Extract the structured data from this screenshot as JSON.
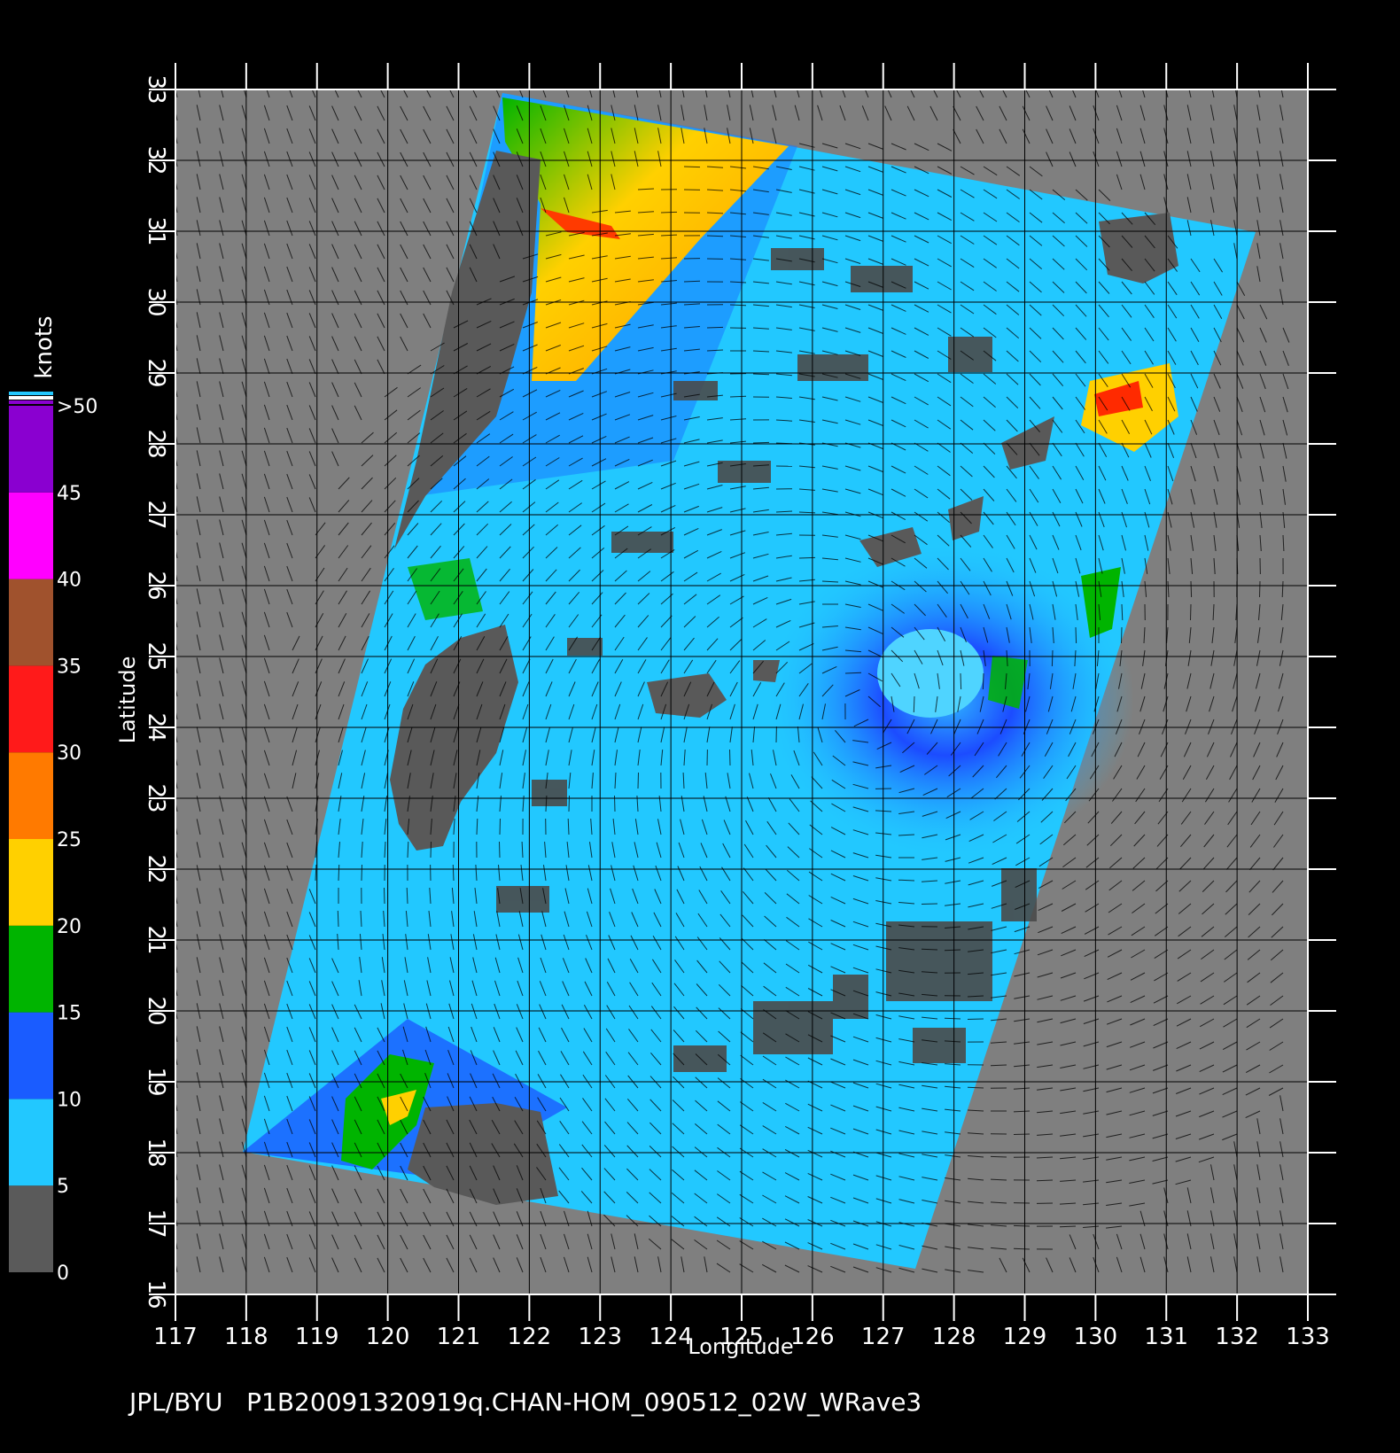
{
  "figure": {
    "footer": "JPL/BYU   P1B20091320919q.CHAN-HOM_090512_02W_WRave3",
    "colorbar": {
      "unit_label": "knots",
      "ticks": [
        "0",
        "5",
        "10",
        "15",
        "20",
        "25",
        "30",
        "35",
        "40",
        "45",
        ">50"
      ],
      "colors": {
        "0-5": "#5a5a5a",
        "5-10": "#22c8ff",
        "10-15": "#1a5cff",
        "15-20": "#00b400",
        "20-25": "#ffd000",
        "25-30": "#ff7a00",
        "30-35": "#ff1a1a",
        "35-40": "#a0522d",
        "40-45": "#ff00ff",
        "45-50": "#8a00d0"
      }
    },
    "axes": {
      "xlabel": "Longitude",
      "ylabel": "Latitude",
      "x_ticks": [
        "117",
        "118",
        "119",
        "120",
        "121",
        "122",
        "123",
        "124",
        "125",
        "126",
        "127",
        "128",
        "129",
        "130",
        "131",
        "132",
        "133"
      ],
      "y_ticks": [
        "16",
        "17",
        "18",
        "19",
        "20",
        "21",
        "22",
        "23",
        "24",
        "25",
        "26",
        "27",
        "28",
        "29",
        "30",
        "31",
        "32",
        "33"
      ],
      "xlim": [
        117,
        133
      ],
      "ylim": [
        16,
        33
      ],
      "grid": true
    },
    "map": {
      "background_color": "#7f7f7f",
      "land_color": "#595959",
      "typhoon_center": {
        "lon": 126.7,
        "lat": 24.2
      }
    }
  }
}
